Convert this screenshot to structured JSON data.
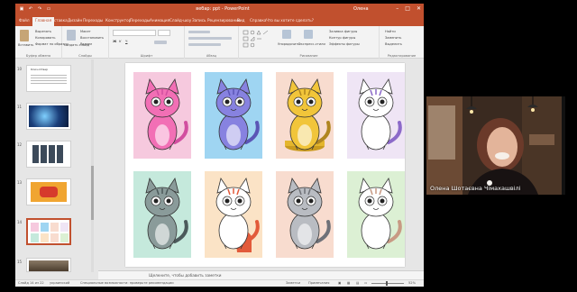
{
  "window": {
    "title": "вебар: ppt - PowerPoint",
    "user": "Олена",
    "win_min": "–",
    "win_max": "□",
    "win_close": "✕"
  },
  "tabs": [
    {
      "label": "Файл",
      "active": false
    },
    {
      "label": "Главная",
      "active": true
    },
    {
      "label": "Вставка",
      "active": false
    },
    {
      "label": "Дизайн",
      "active": false
    },
    {
      "label": "Переходы",
      "active": false
    },
    {
      "label": "Конструктор",
      "active": false
    },
    {
      "label": "Переходы",
      "active": false
    },
    {
      "label": "Анимация",
      "active": false
    },
    {
      "label": "Слайд-шоу",
      "active": false
    },
    {
      "label": "Запись",
      "active": false
    },
    {
      "label": "Рецензирование",
      "active": false
    },
    {
      "label": "Вид",
      "active": false
    },
    {
      "label": "Справка",
      "active": false
    },
    {
      "label": "Что вы хотите сделать?",
      "active": false
    }
  ],
  "ribbon": {
    "paste": "Вставить",
    "clipboard_items": [
      "Вырезать",
      "Копировать",
      "Формат по образцу"
    ],
    "new_slide": "Создать слайд",
    "slide_items": [
      "Макет",
      "Восстановить",
      "Раздел"
    ],
    "arrange": "Упорядочить",
    "quick_styles": "Экспресс-стили",
    "shape_items": [
      "Заливка фигуры",
      "Контур фигуры",
      "Эффекты фигуры"
    ],
    "editing_items": [
      "Найти",
      "Заменить",
      "Выделить"
    ],
    "groups": [
      "Буфер обмена",
      "Слайды",
      "Шрифт",
      "Абзац",
      "Рисование",
      "Редактирование"
    ]
  },
  "thumbnails": [
    {
      "num": "10",
      "kind": "text",
      "caption": "Ключ-Отвер"
    },
    {
      "num": "11",
      "kind": "globe"
    },
    {
      "num": "12",
      "kind": "grid"
    },
    {
      "num": "13",
      "kind": "orange"
    },
    {
      "num": "14",
      "kind": "cats",
      "selected": true
    },
    {
      "num": "15",
      "kind": "photo"
    }
  ],
  "slide": {
    "cards": [
      {
        "bg": "#f6c9de",
        "body": "#f26fb5",
        "stripe": "#d24fa0",
        "type": "pink"
      },
      {
        "bg": "#9fd5f2",
        "body": "#8782e0",
        "stripe": "#5b56b6",
        "type": "blue"
      },
      {
        "bg": "#f8dccf",
        "body": "#f1c53a",
        "stripe": "#b08620",
        "type": "gold"
      },
      {
        "bg": "#efe5f5",
        "body": "#ffffff",
        "stripe": "#8c6ac9",
        "type": "white"
      },
      {
        "bg": "#c5e9dc",
        "body": "#8a9b9a",
        "stripe": "#4c5a5b",
        "type": "grey"
      },
      {
        "bg": "#fbe3c6",
        "body": "#ffffff",
        "stripe": "#e25a3a",
        "type": "calico"
      },
      {
        "bg": "#f8dccf",
        "body": "#b9bcc2",
        "stripe": "#6f7178",
        "type": "tabby"
      },
      {
        "bg": "#dcf0d4",
        "body": "#ffffff",
        "stripe": "#c89a84",
        "type": "tan"
      }
    ]
  },
  "notes_placeholder": "Щелкните, чтобы добавить заметки",
  "status": {
    "slide_counter": "Слайд 14 из 22",
    "language": "украинский",
    "accessibility": "Специальные возможности: проверьте рекомендации",
    "notes_btn": "Заметки",
    "comments_btn": "Примечания",
    "zoom": "52%"
  },
  "webcam": {
    "caption": "Олена Шотаєвна Чімахашвілі"
  },
  "colors": {
    "accent": "#c1502e"
  }
}
